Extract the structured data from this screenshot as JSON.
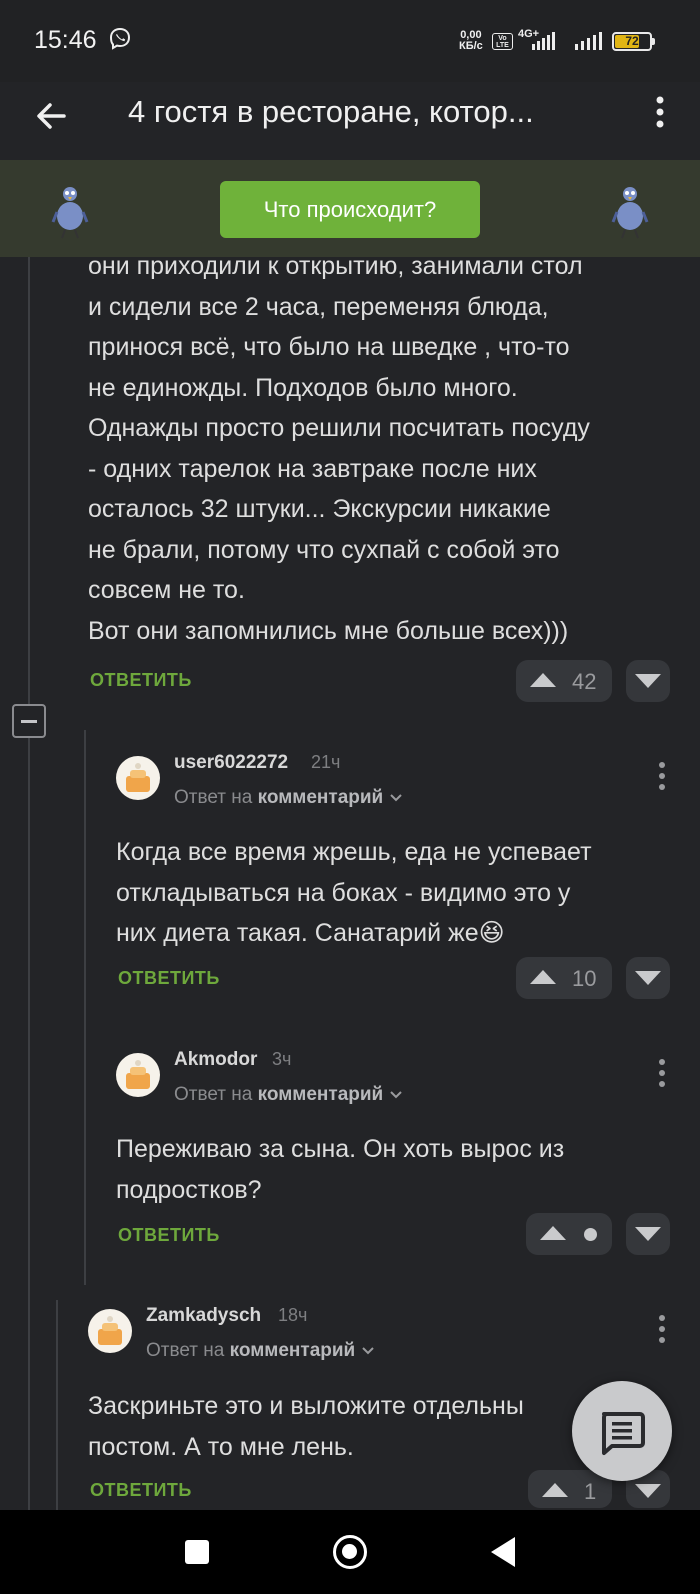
{
  "status_bar": {
    "time": "15:46",
    "net_speed_value": "0,00",
    "net_speed_unit": "КБ/с",
    "volte": "Vo LTE",
    "network": "4G+",
    "battery": "72",
    "battery_level": 0.72,
    "battery_color": "#e0b514",
    "icons": [
      "viber-icon",
      "signal-icon",
      "signal-icon",
      "battery-icon"
    ]
  },
  "app_bar": {
    "title": "4 гостя в ресторане, котор...",
    "back_icon": "arrow-left-icon",
    "more_icon": "more-vert-icon"
  },
  "banner": {
    "button_label": "Что происходит?",
    "accent": "#6fb23a"
  },
  "comments": {
    "parent": {
      "lines": [
        "они приходили к открытию, занимали стол",
        "и сидели все 2 часа, переменяя блюда,",
        "принося всё, что было на шведке , что-то",
        "не единожды. Подходов было много.",
        "Однажды просто решили посчитать посуду",
        "- одних тарелок на завтраке после них",
        "осталось 32 штуки... Экскурсии никакие",
        "не брали, потому что сухпай с собой это",
        "совсем не то.",
        "Вот они запомнились мне больше всех)))"
      ],
      "reply_label": "ОТВЕТИТЬ",
      "votes": "42"
    },
    "reply1": {
      "author": "user6022272",
      "time": "21ч",
      "reply_to_prefix": "Ответ на",
      "reply_to_target": "комментарий",
      "lines": [
        "Когда все время жрешь, еда не успевает",
        "откладываться на боках - видимо это у",
        "них диета такая. Санатарий же😆"
      ],
      "reply_label": "ОТВЕТИТЬ",
      "votes": "10"
    },
    "reply2": {
      "author": "Akmodor",
      "time": "3ч",
      "reply_to_prefix": "Ответ на",
      "reply_to_target": "комментарий",
      "lines": [
        "Переживаю за сына. Он хоть вырос из",
        "подростков?"
      ],
      "reply_label": "ОТВЕТИТЬ"
    },
    "reply3": {
      "author": "Zamkadysch",
      "time": "18ч",
      "reply_to_prefix": "Ответ на",
      "reply_to_target": "комментарий",
      "lines": [
        "Заскриньте это и выложите отдельны",
        "постом. А то мне лень."
      ],
      "reply_label": "ОТВЕТИТЬ",
      "votes": "1"
    }
  },
  "fab": {
    "icon": "comment-icon"
  },
  "nav_bar": {
    "icons": [
      "recents-square-icon",
      "home-circle-icon",
      "back-triangle-icon"
    ]
  }
}
